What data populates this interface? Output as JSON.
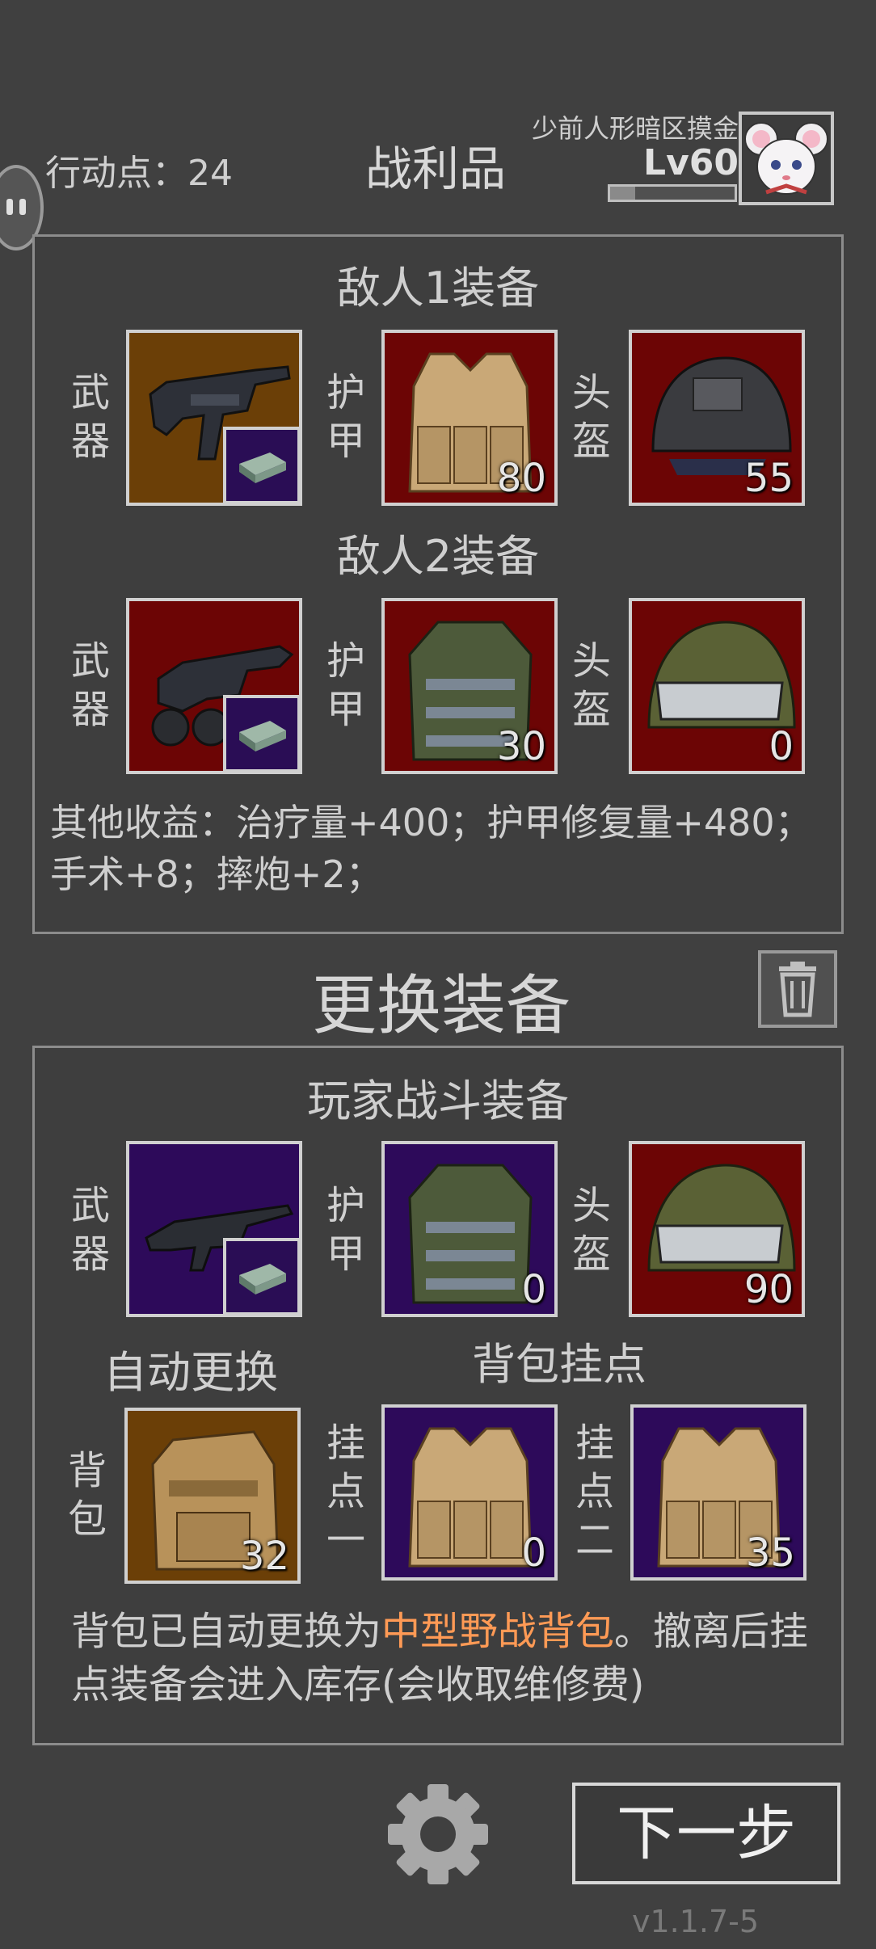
{
  "header": {
    "action_points_label": "行动点：24",
    "title": "战利品",
    "player_name": "少前人形暗区摸金",
    "level": "Lv60",
    "xp_progress": 0.2
  },
  "loot": {
    "enemy1": {
      "title": "敌人1装备",
      "weapon_label": "武器",
      "armor_label": "护甲",
      "helmet_label": "头盔",
      "armor_value": "80",
      "helmet_value": "55"
    },
    "enemy2": {
      "title": "敌人2装备",
      "weapon_label": "武器",
      "armor_label": "护甲",
      "helmet_label": "头盔",
      "armor_value": "30",
      "helmet_value": "0"
    },
    "other_gains": "其他收益：治疗量+400；护甲修复量+480；手术+8；摔炮+2；"
  },
  "change": {
    "title": "更换装备",
    "player_section_title": "玩家战斗装备",
    "weapon_label": "武器",
    "armor_label": "护甲",
    "helmet_label": "头盔",
    "armor_value": "0",
    "helmet_value": "90",
    "auto_replace_label": "自动更换",
    "backpack_mount_title": "背包挂点",
    "backpack_label": "背包",
    "backpack_value": "32",
    "mount1_label": "挂点一",
    "mount1_value": "0",
    "mount2_label": "挂点二",
    "mount2_value": "35",
    "note_prefix": "背包已自动更换为",
    "note_highlight": "中型野战背包",
    "note_suffix": "。撤离后挂点装备会进入库存(会收取维修费)"
  },
  "footer": {
    "next_button": "下一步",
    "version": "v1.1.7-5"
  },
  "colors": {
    "background": "#404040",
    "rarity_orange": "#6b3f07",
    "rarity_red": "#6c0505",
    "rarity_purple": "#2d0a5a",
    "highlight": "#ff9a55"
  },
  "icons": [
    "pause-icon",
    "trash-icon",
    "gear-icon",
    "rifle-icon",
    "ammo-box-icon",
    "plate-carrier-icon",
    "helmet-icon",
    "backpack-icon",
    "avatar-mouse-icon"
  ]
}
